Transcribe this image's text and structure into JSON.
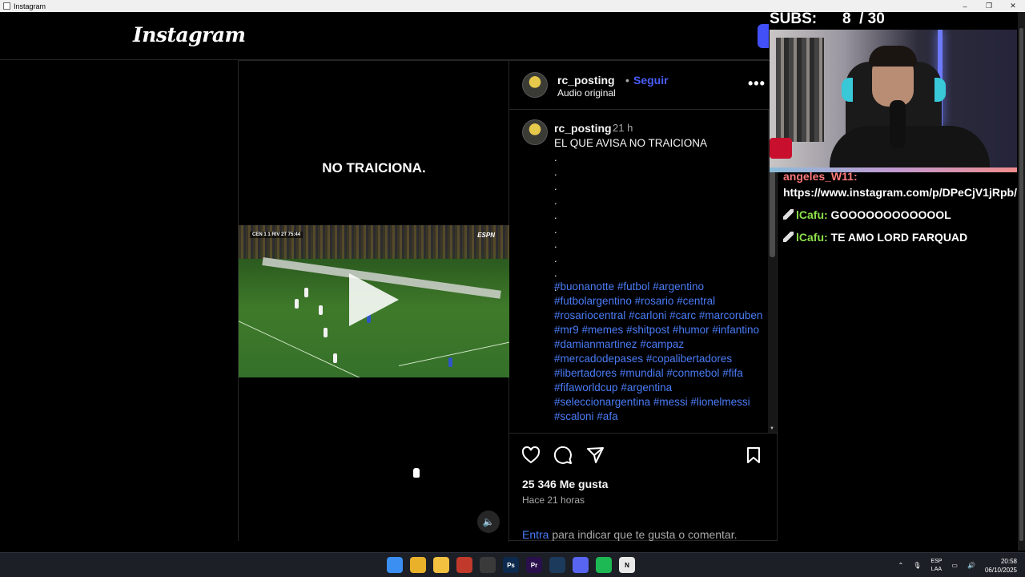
{
  "window": {
    "title": "Instagram",
    "controls": [
      "–",
      "❐",
      "✕"
    ]
  },
  "instagram": {
    "logo": "Instagram",
    "post": {
      "overlay_text": "NO TRAICIONA.",
      "video": {
        "score": "CEN 1 1 RIV 2T 75:44",
        "broadcaster": "ESPN"
      },
      "header": {
        "username": "rc_posting",
        "separator": "•",
        "follow_label": "Seguir",
        "audio_label": "Audio original",
        "more_label": "•••"
      },
      "caption": {
        "username": "rc_posting",
        "time": "21 h",
        "text": "EL QUE AVISA NO TRAICIONA",
        "dot_lines": [
          ".",
          ".",
          ".",
          ".",
          ".",
          ".",
          ".",
          ".",
          ".",
          "."
        ],
        "hashtags": [
          "#buonanotte",
          "#futbol",
          "#argentino",
          "#futbolargentino",
          "#rosario",
          "#central",
          "#rosariocentral",
          "#carloni",
          "#carc",
          "#marcoruben",
          "#mr9",
          "#memes",
          "#shitpost",
          "#humor",
          "#infantino",
          "#damianmartinez",
          "#campaz",
          "#mercadodepases",
          "#copalibertadores",
          "#libertadores",
          "#mundial",
          "#conmebol",
          "#fifa",
          "#fifaworldcup",
          "#argentina",
          "#seleccionargentina",
          "#messi",
          "#lionelmessi",
          "#scaloni",
          "#afa"
        ]
      },
      "likes": "25 346 Me gusta",
      "time_ago": "Hace 21 horas",
      "login_prompt": {
        "link": "Entra",
        "text": " para indicar que te gusta o comentar."
      }
    }
  },
  "stream": {
    "subs_label": "SUBS:",
    "subs_value": "8  / 30",
    "chat": [
      {
        "user": "angeles_W11:",
        "text": " https://www.instagram.com/p/DPeCjV1jRpb/",
        "user_color": "#ff7a7a",
        "badge": false
      },
      {
        "user": "lCafu:",
        "text": " GOOOOOOOOOOOOL",
        "user_color": "#8de04a",
        "badge": true
      },
      {
        "user": "lCafu:",
        "text": " TE AMO LORD FARQUAD",
        "user_color": "#8de04a",
        "badge": true
      }
    ]
  },
  "taskbar": {
    "apps": [
      {
        "name": "windows-start-icon",
        "label": "",
        "color": "#3b8ff3"
      },
      {
        "name": "chrome-icon",
        "label": "",
        "color": "#e9b12a"
      },
      {
        "name": "file-explorer-icon",
        "label": "",
        "color": "#f2c140"
      },
      {
        "name": "app-icon",
        "label": "",
        "color": "#c0392b"
      },
      {
        "name": "obs-icon",
        "label": "",
        "color": "#3a3a3a"
      },
      {
        "name": "photoshop-icon",
        "label": "Ps",
        "color": "#0c2a4d"
      },
      {
        "name": "premiere-icon",
        "label": "Pr",
        "color": "#2a0f4d"
      },
      {
        "name": "steam-icon",
        "label": "",
        "color": "#1b3a5c"
      },
      {
        "name": "discord-icon",
        "label": "",
        "color": "#5865f2"
      },
      {
        "name": "spotify-icon",
        "label": "",
        "color": "#1db954"
      },
      {
        "name": "notion-icon",
        "label": "N",
        "color": "#e9e9e9"
      }
    ],
    "tray": {
      "lang_top": "ESP",
      "lang_bottom": "LAA",
      "time": "20:58",
      "date": "06/10/2025"
    }
  }
}
